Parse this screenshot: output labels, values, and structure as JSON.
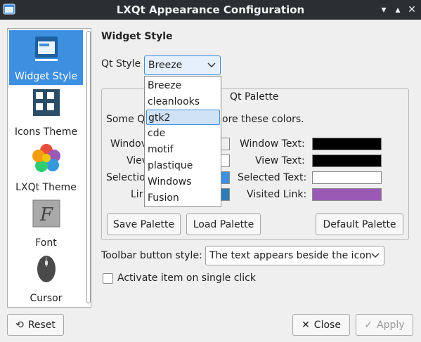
{
  "window": {
    "title": "LXQt Appearance Configuration",
    "min_glyph": "▾",
    "max_glyph": "▴",
    "close_glyph": "✕"
  },
  "sidebar": {
    "items": [
      {
        "label": "Widget Style",
        "icon": "widget-style-icon",
        "selected": true
      },
      {
        "label": "Icons Theme",
        "icon": "icons-theme-icon",
        "selected": false
      },
      {
        "label": "LXQt Theme",
        "icon": "lxqt-theme-icon",
        "selected": false
      },
      {
        "label": "Font",
        "icon": "font-icon",
        "selected": false
      },
      {
        "label": "Cursor",
        "icon": "cursor-icon",
        "selected": false
      }
    ]
  },
  "main": {
    "section_title": "Widget Style",
    "qt_style_label": "Qt Style",
    "qt_style_value": "Breeze",
    "palette": {
      "title": "Qt Palette",
      "description_prefix": "Some Q",
      "description_suffix": "ore these colors.",
      "left_labels": [
        "Windov",
        "Viev",
        "Selectio",
        "Lir"
      ],
      "right_labels": [
        "Window Text:",
        "View Text:",
        "Selected Text:",
        "Visited Link:"
      ],
      "left_colors": [
        "#efefef",
        "#ffffff",
        "#3d8fe0",
        "#2e7bb6"
      ],
      "right_colors": [
        "#000000",
        "#000000",
        "#ffffff",
        "#9b59b6"
      ],
      "save_button": "Save Palette",
      "load_button": "Load Palette",
      "default_button": "Default Palette"
    },
    "toolbar_style_label": "Toolbar button style:",
    "toolbar_style_value": "The text appears beside the icon",
    "single_click_label": "Activate item on single click",
    "single_click_checked": false
  },
  "dropdown": {
    "options": [
      "Breeze",
      "cleanlooks",
      "gtk2",
      "cde",
      "motif",
      "plastique",
      "Windows",
      "Fusion"
    ],
    "highlighted": "gtk2"
  },
  "footer": {
    "reset_label": "Reset",
    "reset_glyph": "⟲",
    "close_label": "Close",
    "close_glyph": "✕",
    "apply_label": "Apply",
    "apply_glyph": "✓"
  },
  "colors": {
    "accent": "#3d8fe0",
    "titlebar": "#2b2f33"
  }
}
